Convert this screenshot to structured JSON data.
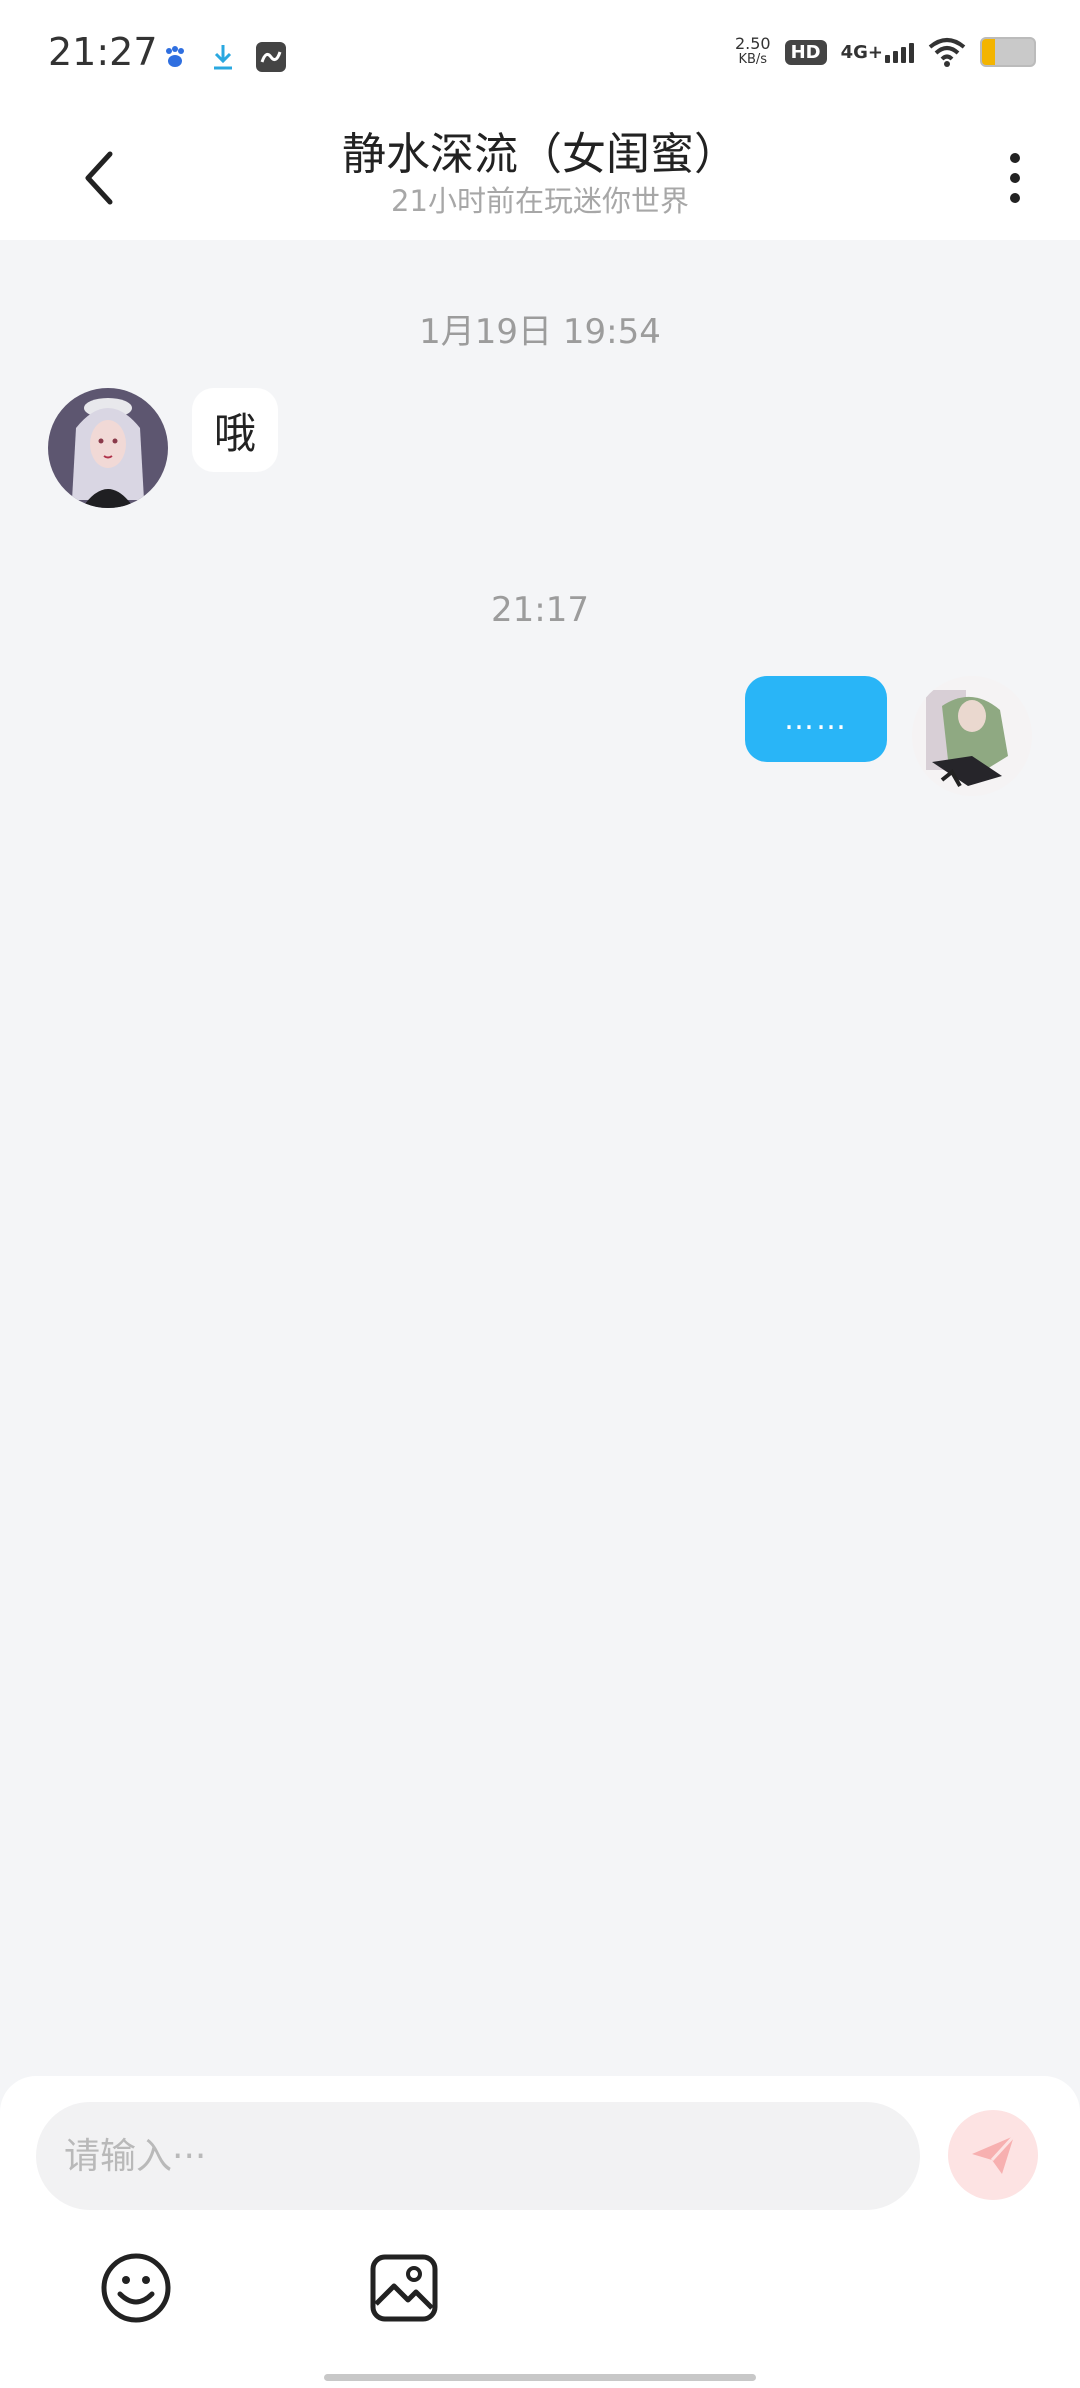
{
  "status_bar": {
    "time": "21:27",
    "icons_left": [
      "baidu-paw-icon",
      "download-icon",
      "app-icon"
    ],
    "net_speed_value": "2.50",
    "net_speed_unit": "KB/s",
    "hd_label": "HD",
    "network_label": "4G+",
    "battery_level": 0.25
  },
  "header": {
    "title": "静水深流（女闺蜜）",
    "subtitle": "21小时前在玩迷你世界"
  },
  "messages": [
    {
      "timestamp": "1月19日 19:54",
      "side": "left",
      "text": "哦"
    },
    {
      "timestamp": "21:17",
      "side": "right",
      "text": "……"
    }
  ],
  "input": {
    "placeholder": "请输入···"
  },
  "colors": {
    "accent": "#29b5f7",
    "send_disabled": "#fde3e3",
    "send_icon": "#f7b0b0",
    "battery": "#f3b400"
  }
}
